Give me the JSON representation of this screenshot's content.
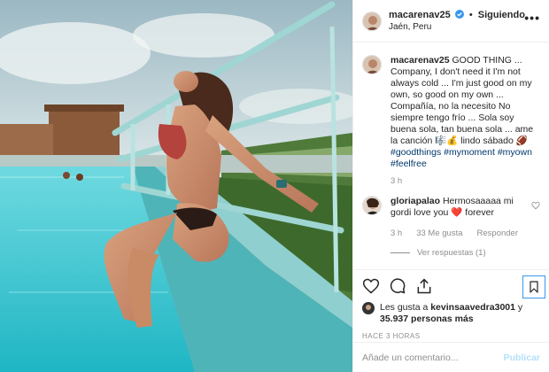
{
  "post": {
    "username": "macarenav25",
    "follow_label": "Siguiendo",
    "location": "Jaén, Peru",
    "more_label": "•••"
  },
  "caption": {
    "username": "macarenav25",
    "text": "GOOD THING ... Company, I don't need it I'm not always cold ... I'm just good on my own, so good on my own ... Compañía, no la necesito No siempre tengo frío ... Sola soy buena sola, tan buena sola ... ame la canción 🎼💰 lindo sábado 🏈",
    "hashtags": "#goodthings #mymoment #myown #feelfree",
    "time": "3 h"
  },
  "comment": {
    "username": "gloriapalao",
    "text": "Hermosaaaaa mi gordi love you ❤️ forever",
    "time": "3 h",
    "likes": "33 Me gusta",
    "reply_label": "Responder",
    "view_replies": "Ver respuestas (1)"
  },
  "likes": {
    "prefix": "Les gusta a",
    "user": "kevinsaavedra3001",
    "connector": "y",
    "count": "35.937 personas más"
  },
  "timestamp": "HACE 3 HORAS",
  "add_comment": {
    "placeholder": "Añade un comentario...",
    "publish_label": "Publicar"
  },
  "icons": [
    "heart-icon",
    "comment-icon",
    "share-icon",
    "bookmark-icon",
    "more-icon",
    "verified-icon"
  ],
  "colors": {
    "link": "#00376b",
    "verified": "#3897f0",
    "muted": "#8e8e8e",
    "publish_disabled": "#b2dffc",
    "pool": "#3fc7cf"
  }
}
